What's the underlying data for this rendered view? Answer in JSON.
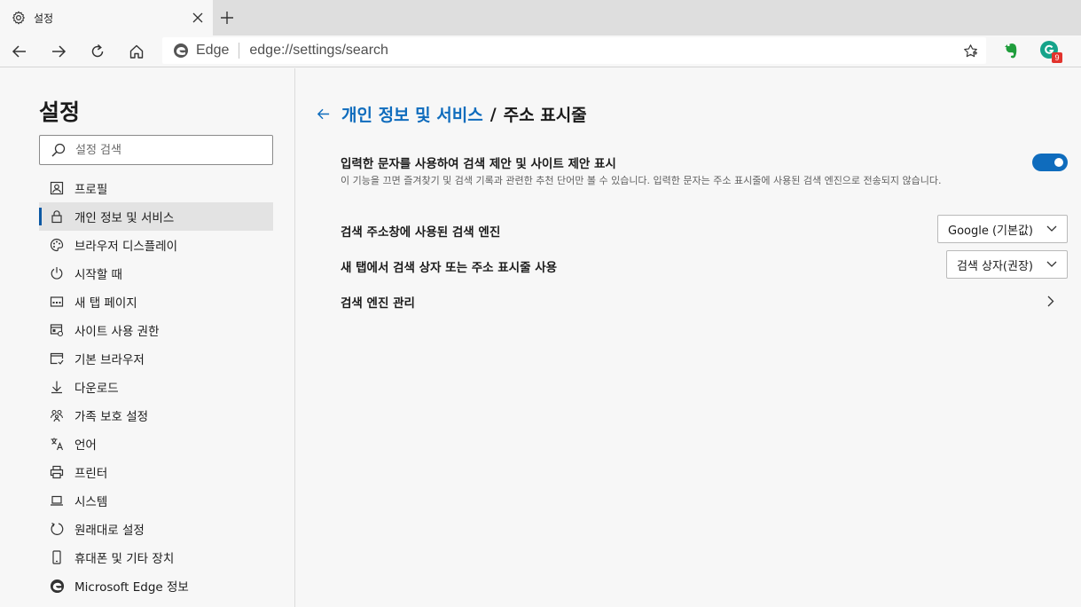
{
  "browser": {
    "tab": {
      "title": "설정"
    },
    "address": {
      "scheme_label": "Edge",
      "url": "edge://settings/search"
    },
    "extensions": {
      "grammarly_badge": "9"
    }
  },
  "sidebar": {
    "title": "설정",
    "search_placeholder": "설정 검색",
    "items": [
      {
        "label": "프로필",
        "icon": "profile-icon"
      },
      {
        "label": "개인 정보 및 서비스",
        "icon": "lock-icon",
        "active": true
      },
      {
        "label": "브라우저 디스플레이",
        "icon": "palette-icon"
      },
      {
        "label": "시작할 때",
        "icon": "power-icon"
      },
      {
        "label": "새 탭 페이지",
        "icon": "new-tab-icon"
      },
      {
        "label": "사이트 사용 권한",
        "icon": "site-permissions-icon"
      },
      {
        "label": "기본 브라우저",
        "icon": "default-browser-icon"
      },
      {
        "label": "다운로드",
        "icon": "download-icon"
      },
      {
        "label": "가족 보호 설정",
        "icon": "family-icon"
      },
      {
        "label": "언어",
        "icon": "language-icon"
      },
      {
        "label": "프린터",
        "icon": "printer-icon"
      },
      {
        "label": "시스템",
        "icon": "laptop-icon"
      },
      {
        "label": "원래대로 설정",
        "icon": "reset-icon"
      },
      {
        "label": "휴대폰 및 기타 장치",
        "icon": "phone-icon"
      },
      {
        "label": "Microsoft Edge 정보",
        "icon": "edge-logo-icon"
      }
    ]
  },
  "main": {
    "breadcrumb": {
      "parent": "개인 정보 및 서비스",
      "separator": "/",
      "current": "주소 표시줄"
    },
    "settings": {
      "suggestions": {
        "title": "입력한 문자를 사용하여 검색 제안 및 사이트 제안 표시",
        "description": "이 기능을 끄면 즐겨찾기 및 검색 기록과 관련한 추천 단어만 볼 수 있습니다. 입력한 문자는 주소 표시줄에 사용된 검색 엔진으로 전송되지 않습니다.",
        "enabled": true
      },
      "search_engine": {
        "title": "검색 주소창에 사용된 검색 엔진",
        "value": "Google (기본값)"
      },
      "new_tab_search": {
        "title": "새 탭에서 검색 상자 또는 주소 표시줄 사용",
        "value": "검색 상자(권장)"
      },
      "manage_engines": {
        "title": "검색 엔진 관리"
      }
    }
  },
  "colors": {
    "accent": "#0f6cbd",
    "active_indicator": "#0c59a4",
    "background": "#f7f7f7"
  }
}
